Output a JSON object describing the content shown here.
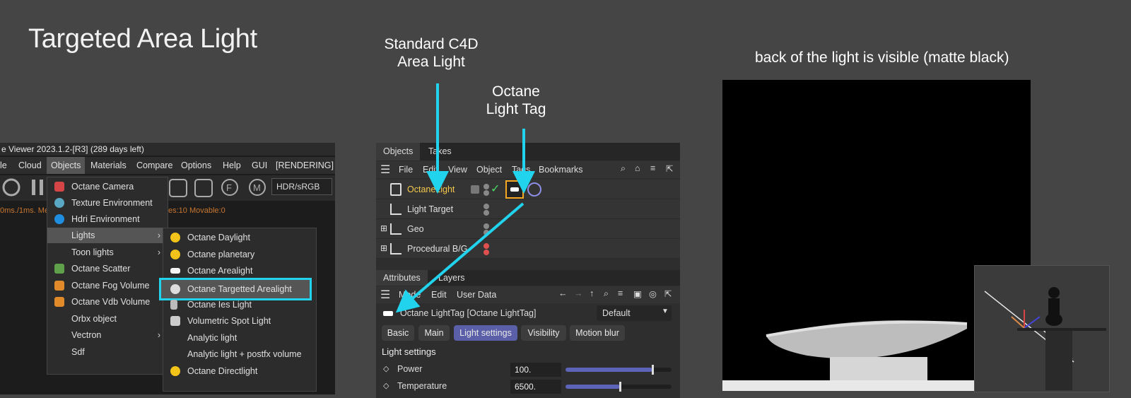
{
  "slide": {
    "title": "Targeted Area Light",
    "annot_std": "Standard C4D\nArea Light",
    "annot_tag": "Octane\nLight Tag",
    "note_back": "back of the light is visible (matte black)"
  },
  "viewer": {
    "title": "e Viewer 2023.1.2-[R3] (289 days left)",
    "menu": [
      "le",
      "Cloud",
      "Objects",
      "Materials",
      "Compare",
      "Options",
      "Help",
      "GUI",
      "[RENDERING]"
    ],
    "color_space": "HDR/sRGB",
    "status": "0ms./1ms. Me",
    "status2": "es:10 Movable:0"
  },
  "objects_menu": [
    {
      "label": "Octane Camera",
      "icon": "camera-icon",
      "color": "#d64545"
    },
    {
      "label": "Texture Environment",
      "icon": "texture-env-icon",
      "color": "#5aa7c4"
    },
    {
      "label": "Hdri Environment",
      "icon": "hdri-env-icon",
      "color": "#1f8ee0"
    },
    {
      "label": "Lights",
      "icon": "",
      "submenu": true
    },
    {
      "label": "Toon lights",
      "icon": "",
      "submenu": true
    },
    {
      "label": "Octane Scatter",
      "icon": "scatter-icon",
      "color": "#5fa14a"
    },
    {
      "label": "Octane Fog Volume",
      "icon": "fog-volume-icon",
      "color": "#e08a2a"
    },
    {
      "label": "Octane Vdb Volume",
      "icon": "vdb-volume-icon",
      "color": "#e08a2a"
    },
    {
      "label": "Orbx object",
      "icon": ""
    },
    {
      "label": "Vectron",
      "icon": "",
      "submenu": true
    },
    {
      "label": "Sdf",
      "icon": ""
    }
  ],
  "lights_menu": [
    {
      "label": "Octane Daylight",
      "icon": "sun-icon"
    },
    {
      "label": "Octane planetary",
      "icon": "sun-icon"
    },
    {
      "label": "Octane Arealight",
      "icon": "arealight-icon"
    },
    {
      "label": "Octane Targetted Arealight",
      "icon": "targeted-arealight-icon",
      "highlight": true
    },
    {
      "label": "Octane Ies Light",
      "icon": "ies-light-icon"
    },
    {
      "label": "Volumetric Spot Light",
      "icon": "spotlight-icon"
    },
    {
      "label": "Analytic light",
      "icon": ""
    },
    {
      "label": "Analytic light + postfx volume",
      "icon": ""
    },
    {
      "label": "Octane Directlight",
      "icon": "sun-icon"
    }
  ],
  "c4d": {
    "tabs": [
      "Objects",
      "Takes"
    ],
    "menu": [
      "File",
      "Edit",
      "View",
      "Object",
      "Tags",
      "Bookmarks"
    ],
    "objects": [
      {
        "name": "OctaneLight",
        "selected": true,
        "dot2": "#888"
      },
      {
        "name": "Light Target",
        "dot2": "#888"
      },
      {
        "name": "Geo",
        "dot2": "#888"
      },
      {
        "name": "Procedural B/G",
        "dot2": "#e05050"
      }
    ],
    "attr_tabs": [
      "Attributes",
      "Layers"
    ],
    "attr_menu": [
      "Mode",
      "Edit",
      "User Data"
    ],
    "attr_object": "Octane LightTag [Octane LightTag]",
    "attr_preset": "Default",
    "pills": [
      "Basic",
      "Main",
      "Light settings",
      "Visibility",
      "Motion blur"
    ],
    "section": "Light settings",
    "params": [
      {
        "label": "Power",
        "value": "100.",
        "fill": 0.82
      },
      {
        "label": "Temperature",
        "value": "6500.",
        "fill": 0.51
      }
    ]
  },
  "colors": {
    "arrow": "#22d3ee",
    "selected_text": "#f5c84c",
    "accent_pill": "#5a5fa8"
  }
}
